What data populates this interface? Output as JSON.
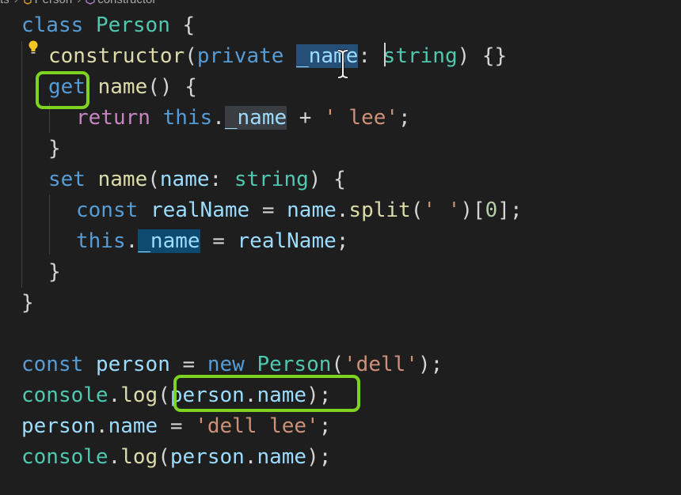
{
  "breadcrumb": {
    "items": [
      "ts",
      "Person",
      "constructor"
    ]
  },
  "colors": {
    "background": "#1e1e1e",
    "highlight_box": "#7ed321",
    "keyword": "#569cd6",
    "class": "#4ec9b0",
    "function": "#dcdcaa",
    "variable": "#9cdcfe",
    "string": "#ce9178",
    "control": "#c586c0"
  },
  "icons": {
    "lightbulb": "lightbulb-icon",
    "class_crumb": "class-icon",
    "method_crumb": "method-icon"
  },
  "code": {
    "l1": {
      "kw": "class",
      "cls": "Person",
      "brace": "{"
    },
    "l2": {
      "fn": "constructor",
      "open": "(",
      "mod": "private",
      "param": "_name",
      "colon": ":",
      "type": "string",
      "close": ")",
      "body": "{}"
    },
    "l3": {
      "kw": "get",
      "fn": "name",
      "rest": "() {"
    },
    "l4": {
      "ctrl": "return",
      "this": "this",
      "dot": ".",
      "prop": "_name",
      "op": " + ",
      "str": "' lee'",
      "semi": ";"
    },
    "l5": {
      "brace": "}"
    },
    "l6": {
      "kw": "set",
      "fn": "name",
      "open": "(",
      "param": "name",
      "colon": ":",
      "type": "string",
      "close": ") {"
    },
    "l7": {
      "kw": "const",
      "var": "realName",
      "eq": " = ",
      "obj": "name",
      "dot": ".",
      "fn": "split",
      "open": "(",
      "str": "' '",
      "close": ")[",
      "num": "0",
      "end": "];"
    },
    "l8": {
      "this": "this",
      "dot": ".",
      "prop": "_name",
      "eq": " = ",
      "var": "realName",
      "semi": ";"
    },
    "l9": {
      "brace": "}"
    },
    "l10": {
      "brace": "}"
    },
    "l12": {
      "kw": "const",
      "var": "person",
      "eq": " = ",
      "new": "new",
      "cls": "Person",
      "open": "(",
      "str": "'dell'",
      "close": ");"
    },
    "l13": {
      "obj": "console",
      "dot": ".",
      "fn": "log",
      "open": "(",
      "arg": "person",
      "dot2": ".",
      "prop": "name",
      "close": ");"
    },
    "l14": {
      "obj": "person",
      "dot": ".",
      "prop": "name",
      "eq": " = ",
      "str": "'dell lee'",
      "semi": ";"
    },
    "l15": {
      "obj": "console",
      "dot": ".",
      "fn": "log",
      "open": "(",
      "arg": "person",
      "dot2": ".",
      "prop": "name",
      "close": ");"
    }
  }
}
